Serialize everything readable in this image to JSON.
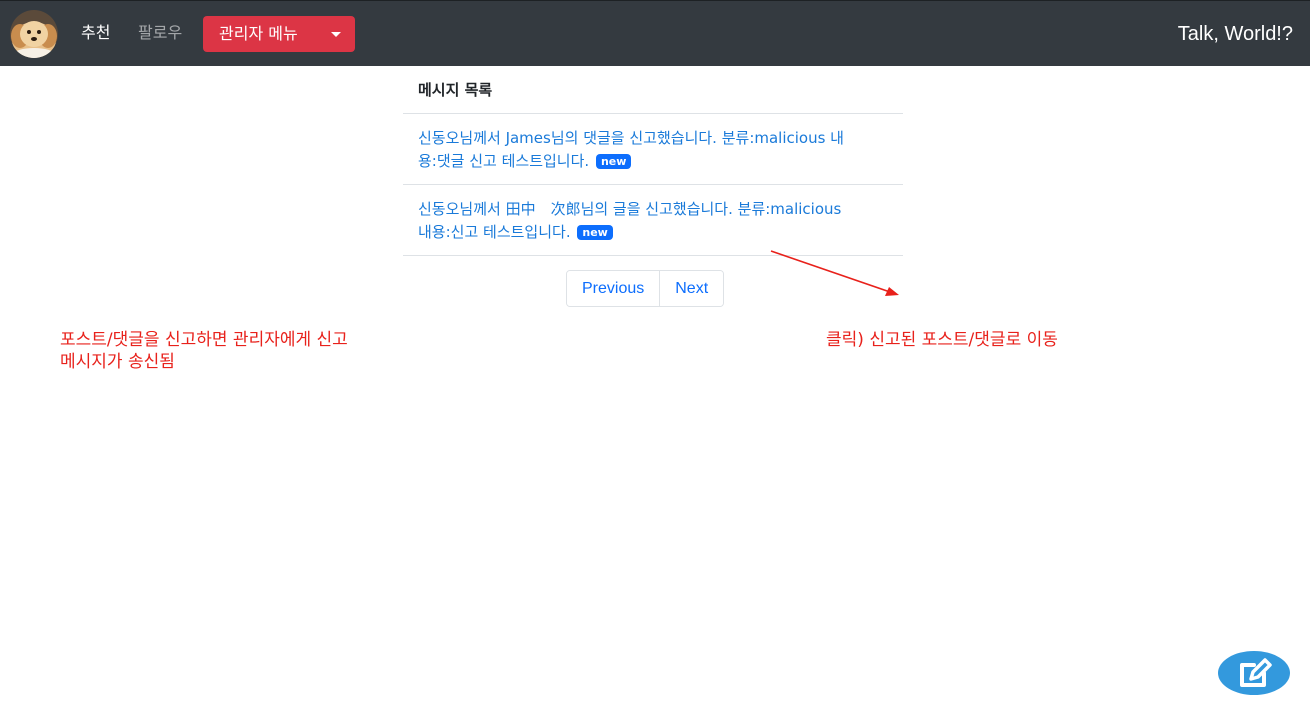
{
  "navbar": {
    "nav_recommend": "추천",
    "nav_follow": "팔로우",
    "admin_menu": "관리자 메뉴",
    "brand": "Talk, World!?"
  },
  "panel": {
    "title": "메시지 목록",
    "messages": [
      {
        "text": "신동오님께서 James님의 댓글을 신고했습니다. 분류:malicious 내용:댓글 신고 테스트입니다.",
        "badge": "new"
      },
      {
        "text": "신동오님께서 田中　次郎님의 글을 신고했습니다. 분류:malicious 내용:신고 테스트입니다.",
        "badge": "new"
      }
    ]
  },
  "pagination": {
    "previous": "Previous",
    "next": "Next"
  },
  "annotations": {
    "left_line1": "포스트/댓글을 신고하면 관리자에게 신고",
    "left_line2": "메시지가 송신됨",
    "right": "클릭) 신고된 포스트/댓글로 이동"
  },
  "colors": {
    "navbar_bg": "#343a40",
    "admin_button": "#dc3545",
    "link": "#1a7ad9",
    "badge": "#0d6efd",
    "annotation": "#e8211b",
    "fab": "#3399dd"
  },
  "icons": [
    "avatar-dog-photo",
    "caret-down-icon",
    "compose-edit-icon",
    "arrow-annotation"
  ]
}
